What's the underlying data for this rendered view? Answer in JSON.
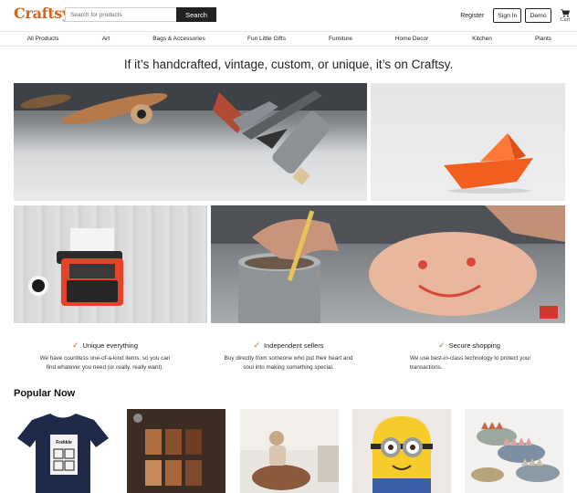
{
  "header": {
    "logo": "Craftsy",
    "search_placeholder": "Search for products",
    "search_button": "Search",
    "register": "Register",
    "sign_in": "Sign In",
    "demo": "Demo",
    "cart_label": "Cart"
  },
  "nav": {
    "items": [
      "All Products",
      "Art",
      "Bags & Accessories",
      "Fun Little Gifts",
      "Furniture",
      "Home Decor",
      "Kitchen",
      "Plants"
    ]
  },
  "tagline": "If it’s handcrafted, vintage, custom, or unique, it’s on Craftsy.",
  "features": [
    {
      "title": "Unique everything",
      "desc_line1": "We have countless one-of-a-kind items, so you can",
      "desc_line2": "find whatever you need (or really, really want)."
    },
    {
      "title": "Independent sellers",
      "desc_line1": "Buy directly from someone who put their heart and",
      "desc_line2": "soul into making something special."
    },
    {
      "title": "Secure shopping",
      "desc_line1": "We use best-in-class technology to protect your",
      "desc_line2": "transactions."
    }
  ],
  "popular": {
    "title": "Popular Now",
    "tshirt_print": "Frekkle"
  },
  "colors": {
    "brand": "#d5641c",
    "dark": "#222222"
  }
}
